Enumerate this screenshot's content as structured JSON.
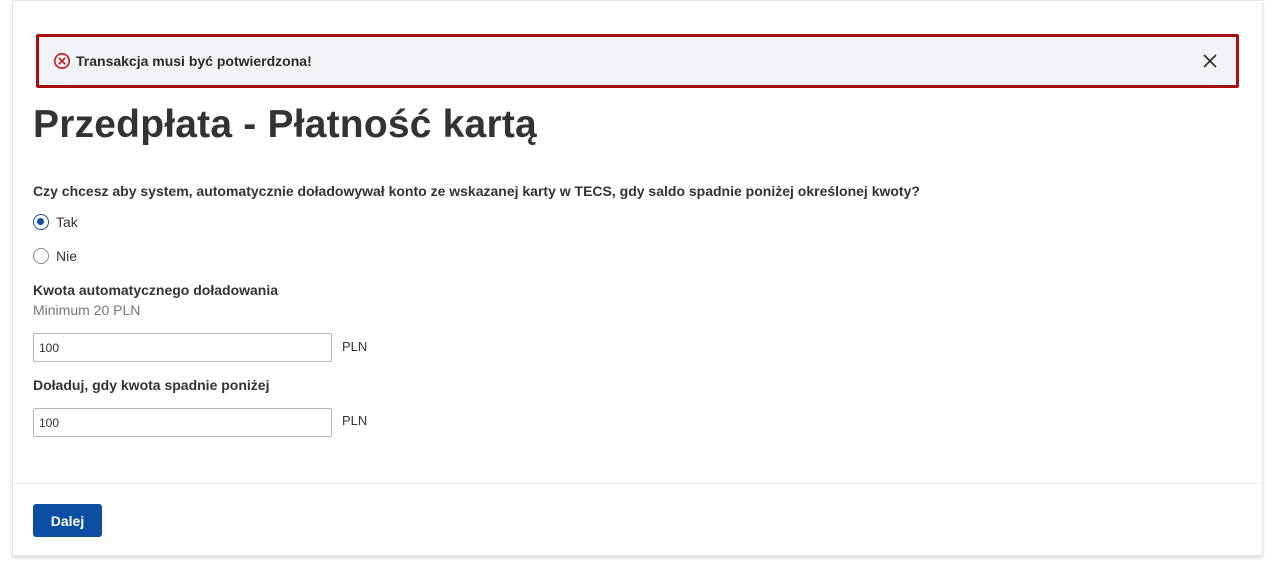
{
  "alert": {
    "icon": "error-circle-icon",
    "message": "Transakcja musi być potwierdzona!",
    "close_icon": "close-icon",
    "border_color": "#a50f12"
  },
  "page": {
    "title": "Przedpłata - Płatność kartą"
  },
  "auto_topup": {
    "question": "Czy chcesz aby system, automatycznie doładowywał konto ze wskazanej karty w TECS, gdy saldo spadnie poniżej określonej kwoty?",
    "options": [
      {
        "label": "Tak",
        "checked": true
      },
      {
        "label": "Nie",
        "checked": false
      }
    ]
  },
  "topup_amount": {
    "label": "Kwota automatycznego doładowania",
    "hint": "Minimum 20 PLN",
    "value": "100",
    "unit": "PLN"
  },
  "threshold": {
    "label": "Doładuj, gdy kwota spadnie poniżej",
    "value": "100",
    "unit": "PLN"
  },
  "footer": {
    "next_label": "Dalej",
    "accent": "#0b4ea2"
  }
}
